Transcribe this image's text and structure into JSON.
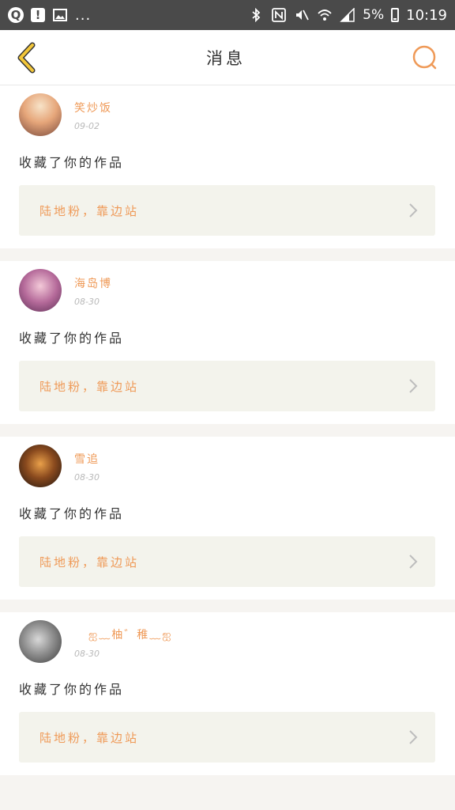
{
  "statusbar": {
    "battery_percent": "5%",
    "time": "10:19",
    "dots": "..."
  },
  "nav": {
    "title": "消息"
  },
  "messages": [
    {
      "username": "笑炒饭",
      "date": "09-02",
      "action": "收藏了你的作品",
      "work_title": "陆地粉，靠边站"
    },
    {
      "username": "海岛博",
      "date": "08-30",
      "action": "收藏了你的作品",
      "work_title": "陆地粉，靠边站"
    },
    {
      "username": "雪追",
      "date": "08-30",
      "action": "收藏了你的作品",
      "work_title": "陆地粉，靠边站"
    },
    {
      "username": "ஐ﹏柚゛稚﹏ஐ",
      "date": "08-30",
      "action": "收藏了你的作品",
      "work_title": "陆地粉，靠边站"
    }
  ],
  "colors": {
    "accent": "#ef9a58",
    "back_arrow": "#f2c63a",
    "statusbar": "#4a4a4a"
  }
}
